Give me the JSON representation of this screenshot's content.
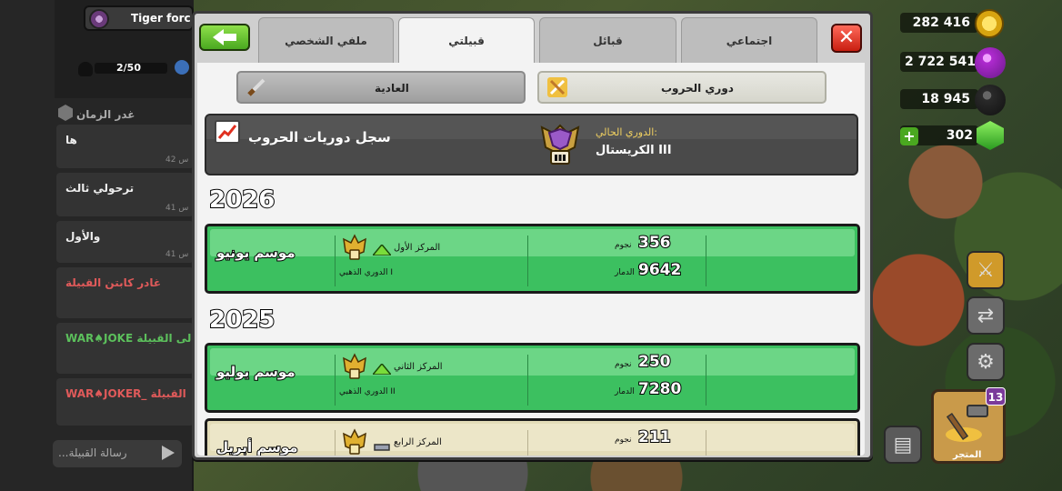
{
  "chat": {
    "clan_name": "Tiger forc",
    "donations": "2/50",
    "section_label": "غدر الزمان",
    "messages": [
      {
        "text": "ها",
        "time": "س 42",
        "color": "normal"
      },
      {
        "text": "ترحولي ثالث",
        "time": "س 41",
        "color": "normal"
      },
      {
        "text": "والأول",
        "time": "س 41",
        "color": "normal"
      },
      {
        "text": "غادر كابتن القبيلة",
        "time": "",
        "color": "red"
      },
      {
        "text": "WAR♠JOKE إلى القبيلة",
        "time": "",
        "color": "green"
      },
      {
        "text": "WAR♠JOKER_ القبيلة",
        "time": "",
        "color": "red"
      }
    ],
    "input_placeholder": "...رسالة القبيلة"
  },
  "hud": {
    "gold": "282 416",
    "elixir": "2 722 541",
    "dark_elixir": "18 945",
    "gems": "302",
    "shop_label": "المتجر",
    "shop_badge": "13",
    "icons": {
      "gold": "gold-coin-icon",
      "elixir": "elixir-drop-icon",
      "dark_elixir": "dark-elixir-icon",
      "gems": "gem-icon",
      "plus": "plus-icon"
    }
  },
  "tabs": [
    {
      "label": "ملفي الشخصي",
      "active": false
    },
    {
      "label": "قبيلتي",
      "active": true
    },
    {
      "label": "قبائل",
      "active": false
    },
    {
      "label": "اجتماعي",
      "active": false
    }
  ],
  "subtabs": [
    {
      "label": "العادية",
      "icon": "sword-icon",
      "active": false
    },
    {
      "label": "دوري الحروب",
      "icon": "crossed-swords-icon",
      "active": true
    }
  ],
  "log": {
    "title": "سجل دوريات الحروب",
    "current_league_label": "الدوري الحالي:",
    "current_league_name": "الكريستال III"
  },
  "years": [
    {
      "year": "2026",
      "seasons": [
        {
          "name": "موسم يونيو",
          "rank": "المركز الأول",
          "league": "الدوري الذهبي I",
          "stars": "356",
          "destruction": "9642",
          "stars_label": "نجوم",
          "destruction_label": "الدمار",
          "state": "promoted"
        }
      ]
    },
    {
      "year": "2025",
      "seasons": [
        {
          "name": "موسم يوليو",
          "rank": "المركز الثاني",
          "league": "الدوري الذهبي II",
          "stars": "250",
          "destruction": "7280",
          "stars_label": "نجوم",
          "destruction_label": "الدمار",
          "state": "promoted"
        },
        {
          "name": "موسم أبريل",
          "rank": "المركز الرابع",
          "league": "",
          "stars": "211",
          "destruction": "",
          "stars_label": "نجوم",
          "destruction_label": "",
          "state": "stayed"
        }
      ]
    }
  ],
  "colors": {
    "promoted": "#3cc060",
    "stayed": "#e3dcb8",
    "close": "#c81e10",
    "back": "#4aa820"
  }
}
